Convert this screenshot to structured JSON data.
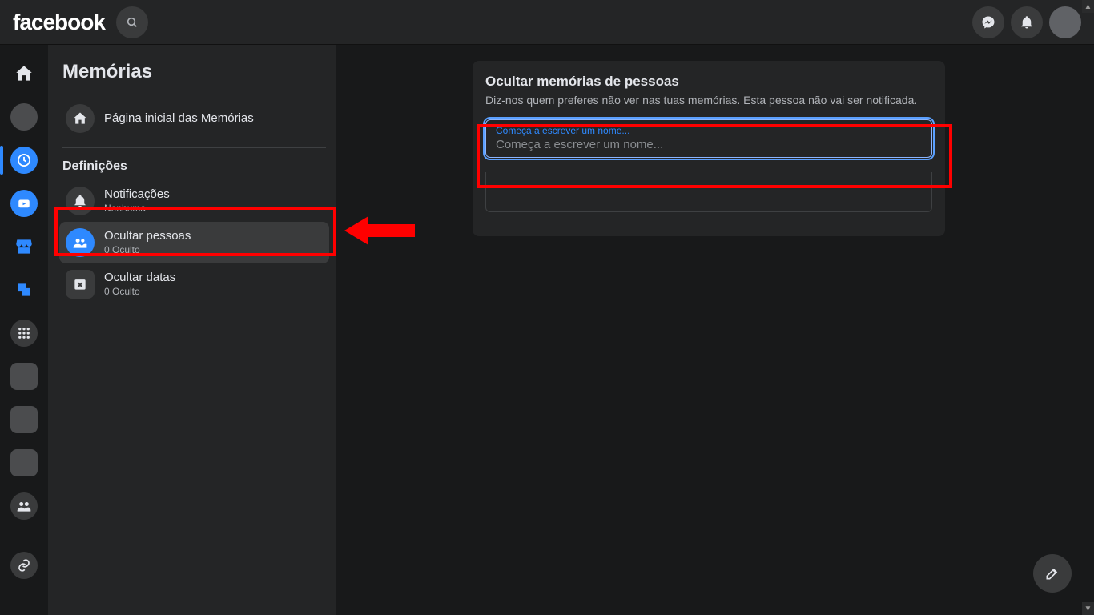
{
  "logo_text": "facebook",
  "sidebar": {
    "title": "Memórias",
    "home_label": "Página inicial das Memórias",
    "settings_header": "Definições",
    "items": [
      {
        "label": "Notificações",
        "sub": "Nenhuma"
      },
      {
        "label": "Ocultar pessoas",
        "sub": "0 Oculto"
      },
      {
        "label": "Ocultar datas",
        "sub": "0 Oculto"
      }
    ]
  },
  "card": {
    "title": "Ocultar memórias de pessoas",
    "desc": "Diz-nos quem preferes não ver nas tuas memórias. Esta pessoa não vai ser notificada.",
    "float_label": "Começa a escrever um nome...",
    "placeholder": "Começa a escrever um nome..."
  }
}
